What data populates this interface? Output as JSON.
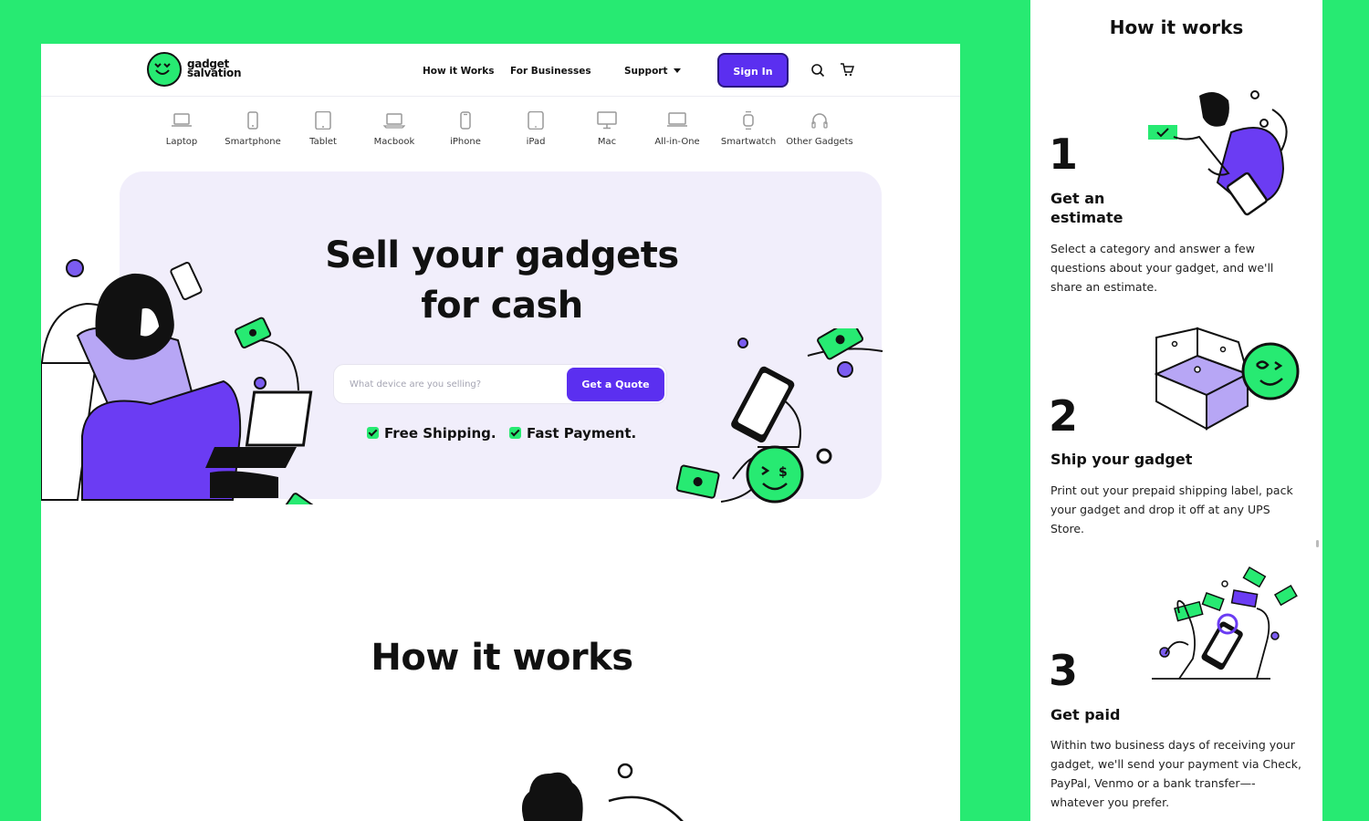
{
  "brand": {
    "line1": "gadget",
    "line2": "salvation"
  },
  "nav": {
    "how_it_works": "How it Works",
    "for_businesses": "For Businesses",
    "support": "Support",
    "sign_in": "Sign In"
  },
  "categories": [
    "Laptop",
    "Smartphone",
    "Tablet",
    "Macbook",
    "iPhone",
    "iPad",
    "Mac",
    "All-in-One",
    "Smartwatch",
    "Other Gadgets"
  ],
  "hero": {
    "title_line1": "Sell your gadgets",
    "title_line2": "for cash",
    "search_placeholder": "What device are you selling?",
    "quote_button": "Get a Quote",
    "perk1": "Free Shipping.",
    "perk2": "Fast Payment."
  },
  "section": {
    "how_title": "How it works"
  },
  "side": {
    "title": "How it works",
    "steps": [
      {
        "num": "1",
        "title_line1": "Get an",
        "title_line2": "estimate",
        "desc": "Select a category and answer a few questions about your gadget, and we'll share an estimate."
      },
      {
        "num": "2",
        "title": "Ship your gadget",
        "desc": "Print out your prepaid shipping label, pack your gadget and drop it off at any UPS Store."
      },
      {
        "num": "3",
        "title": "Get paid",
        "desc": "Within two business days of receiving your gadget, we'll send your payment via Check, PayPal, Venmo or a bank transfer—-whatever you prefer."
      }
    ]
  },
  "colors": {
    "background": "#27ea72",
    "accent": "#5b2ff0",
    "hero_bg": "#f1eefb",
    "lilac": "#b7a6f5"
  }
}
